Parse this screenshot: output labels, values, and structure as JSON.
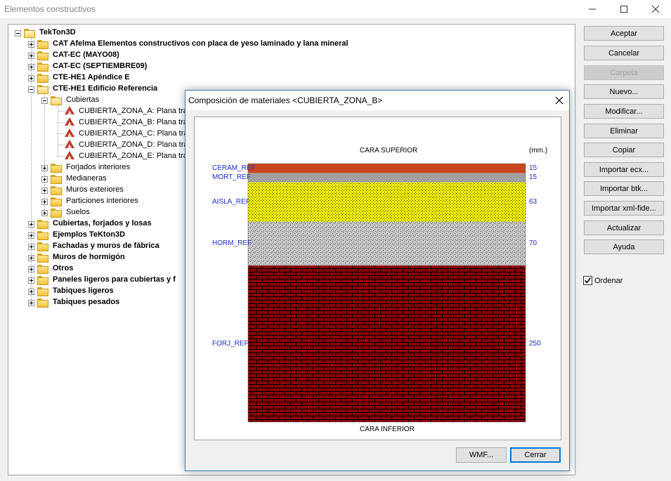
{
  "window": {
    "title": "Elementos constructivos"
  },
  "tree": {
    "root": "TekTon3D",
    "groups": [
      "CAT Afelma Elementos constructivos con placa de yeso laminado y lana mineral",
      "CAT-EC (MAYO08)",
      "CAT-EC (SEPTIEMBRE09)",
      "CTE-HE1 Apéndice E",
      "CTE-HE1 Edificio Referencia"
    ],
    "subfolder_open": "Cubiertas",
    "elements": [
      "CUBIERTA_ZONA_A: Plana tran",
      "CUBIERTA_ZONA_B: Plana tran",
      "CUBIERTA_ZONA_C: Plana tran",
      "CUBIERTA_ZONA_D: Plana tran",
      "CUBIERTA_ZONA_E: Plana tran"
    ],
    "subfolders": [
      "Forjados interiores",
      "Medianeras",
      "Muros exteriores",
      "Particiones interiores",
      "Suelos"
    ],
    "groups2": [
      "Cubiertas, forjados y losas",
      "Ejemplos TeKton3D",
      "Fachadas y muros de fábrica",
      "Muros de hormigón",
      "Otros",
      "Paneles ligeros para cubiertas y f",
      "Tabiques ligeros",
      "Tabiques pesados"
    ]
  },
  "buttons": {
    "aceptar": "Aceptar",
    "cancelar": "Cancelar",
    "carpeta": "Carpeta",
    "nuevo": "Nuevo...",
    "modificar": "Modificar...",
    "eliminar": "Eliminar",
    "copiar": "Copiar",
    "importar_ecx": "Importar ecx...",
    "importar_btk": "Importar btk...",
    "importar_xml": "Importar xml-fide...",
    "actualizar": "Actualizar",
    "ayuda": "Ayuda"
  },
  "ordenar": {
    "label": "Ordenar",
    "checked": true
  },
  "dialog": {
    "title": "Composición de materiales <CUBIERTA_ZONA_B>",
    "top_label": "CARA SUPERIOR",
    "unit_label": "(mm.)",
    "bottom_label": "CARA INFERIOR",
    "wmf_label": "WMF...",
    "close_label": "Cerrar",
    "layers": [
      {
        "name": "CERAM_REF",
        "thickness": 15,
        "pattern": "solid",
        "color": "#c8461e"
      },
      {
        "name": "MORT_REF",
        "thickness": 15,
        "pattern": "solid",
        "color": "#a0a0a0"
      },
      {
        "name": "AISLA_REF",
        "thickness": 63,
        "pattern": "dots",
        "color": "#ffff00"
      },
      {
        "name": "HORM_REF",
        "thickness": 70,
        "pattern": "speckle",
        "color": "#c8c8c8"
      },
      {
        "name": "FORJ_REF",
        "thickness": 250,
        "pattern": "brick",
        "color": "#8b0000"
      }
    ]
  }
}
